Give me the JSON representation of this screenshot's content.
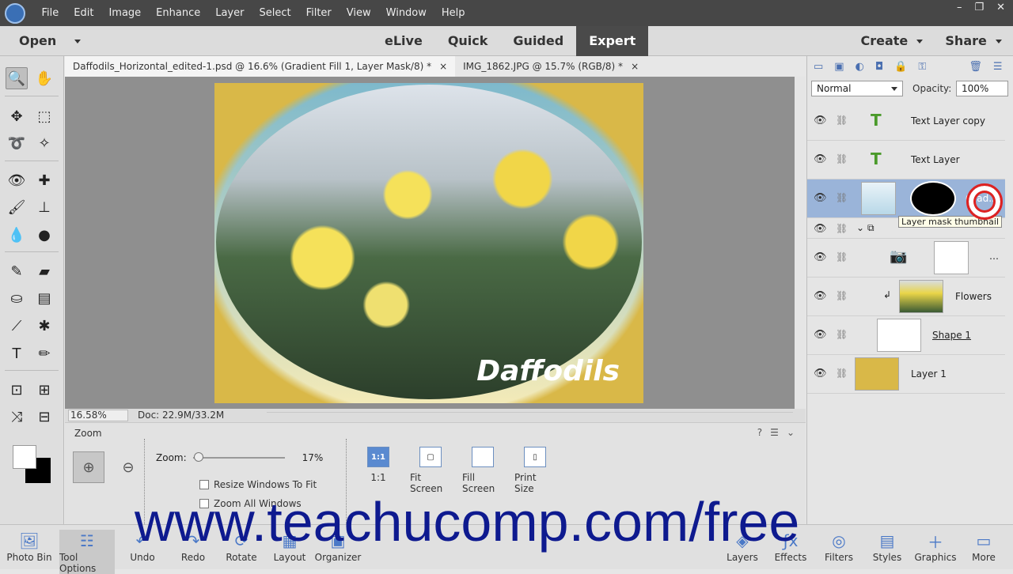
{
  "menubar": {
    "items": [
      "File",
      "Edit",
      "Image",
      "Enhance",
      "Layer",
      "Select",
      "Filter",
      "View",
      "Window",
      "Help"
    ],
    "window_controls": [
      "–",
      "❐",
      "✕"
    ]
  },
  "modebar": {
    "open": "Open",
    "tabs": [
      "eLive",
      "Quick",
      "Guided",
      "Expert"
    ],
    "active_tab": "Expert",
    "create": "Create",
    "share": "Share"
  },
  "doc_tabs": [
    {
      "label": "Daffodils_Horizontal_edited-1.psd @ 16.6% (Gradient Fill 1, Layer Mask/8) *",
      "close": "×"
    },
    {
      "label": "IMG_1862.JPG @ 15.7% (RGB/8) *",
      "close": "×"
    }
  ],
  "canvas": {
    "overlay_text": "Daffodils"
  },
  "status": {
    "zoom": "16.58%",
    "doc": "Doc: 22.9M/33.2M"
  },
  "tool_options": {
    "title": "Zoom",
    "zoom_label": "Zoom:",
    "zoom_value": "17%",
    "zoom_level": 0.17,
    "resize_windows": "Resize Windows To Fit",
    "zoom_all": "Zoom All Windows",
    "buttons": [
      "1:1",
      "Fit Screen",
      "Fill Screen",
      "Print Size"
    ],
    "one_to_one_icon": "1:1"
  },
  "layers_panel": {
    "blend_mode": "Normal",
    "opacity_label": "Opacity:",
    "opacity_value": "100%",
    "layers": [
      "Text Layer copy",
      "Text Layer",
      "Grad...",
      "",
      "",
      "Flowers",
      "Shape 1",
      "Layer 1"
    ],
    "tooltip": "Layer mask thumbnail"
  },
  "taskbar": {
    "left": [
      "Photo Bin",
      "Tool Options",
      "Undo",
      "Redo",
      "Rotate",
      "Layout",
      "Organizer"
    ],
    "right": [
      "Layers",
      "Effects",
      "Filters",
      "Styles",
      "Graphics",
      "More"
    ]
  },
  "watermark": "www.teachucomp.com/free"
}
